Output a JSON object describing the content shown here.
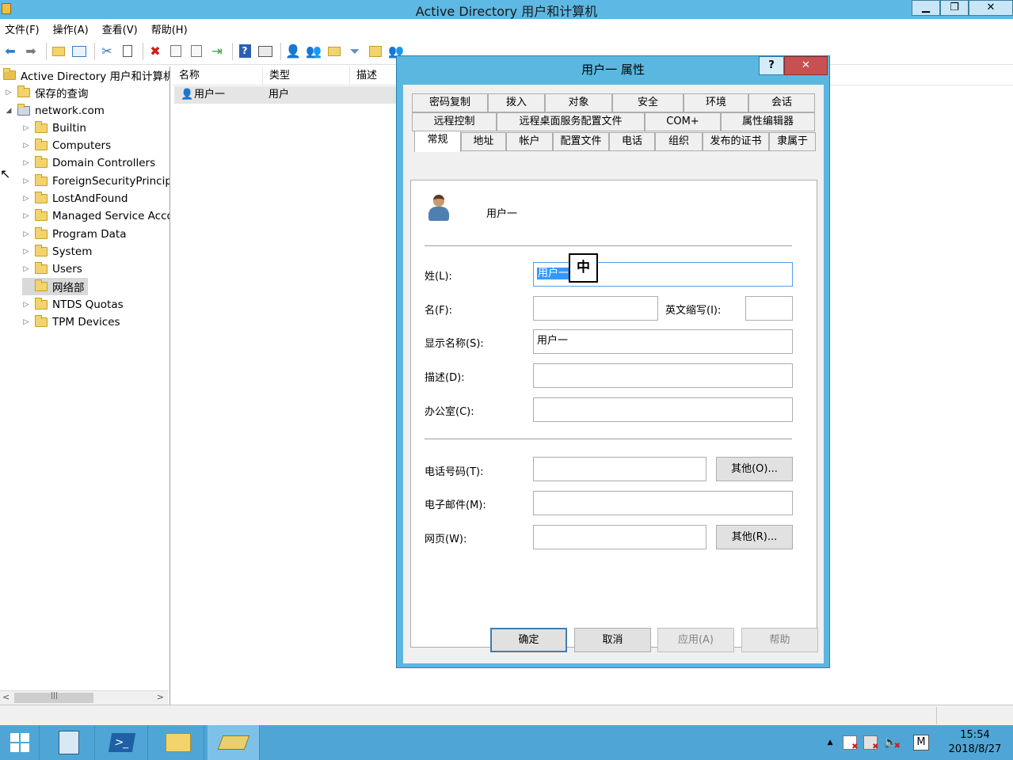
{
  "window": {
    "title": "Active Directory 用户和计算机"
  },
  "menu": [
    "文件(F)",
    "操作(A)",
    "查看(V)",
    "帮助(H)"
  ],
  "toolbar_icons": [
    "back-arrow-icon",
    "forward-arrow-icon",
    "up-folder-icon",
    "show-tree-icon",
    "cut-icon",
    "copy-icon",
    "delete-icon",
    "properties-icon",
    "refresh-icon",
    "export-icon",
    "help-icon",
    "console-icon",
    "new-user-icon",
    "new-group-icon",
    "new-ou-icon",
    "filter-icon",
    "find-icon",
    "add-to-group-icon"
  ],
  "tree": {
    "root": "Active Directory 用户和计算机",
    "saved_queries": "保存的查询",
    "domain": "network.com",
    "children": [
      "Builtin",
      "Computers",
      "Domain Controllers",
      "ForeignSecurityPrincipals",
      "LostAndFound",
      "Managed Service Accounts",
      "Program Data",
      "System",
      "Users",
      "网络部",
      "NTDS Quotas",
      "TPM Devices"
    ]
  },
  "list": {
    "columns": [
      "名称",
      "类型",
      "描述"
    ],
    "rows": [
      {
        "name": "用户一",
        "type": "用户",
        "desc": ""
      }
    ]
  },
  "dialog": {
    "title": "用户一 属性",
    "help_btn": "?",
    "close_btn": "✕",
    "tabs_row1": [
      "密码复制",
      "拨入",
      "对象",
      "安全",
      "环境",
      "会话"
    ],
    "tabs_row2": [
      "远程控制",
      "远程桌面服务配置文件",
      "COM+",
      "属性编辑器"
    ],
    "tabs_row3": [
      "常规",
      "地址",
      "帐户",
      "配置文件",
      "电话",
      "组织",
      "发布的证书",
      "隶属于"
    ],
    "user_name": "用户一",
    "fields": {
      "last_name_label": "姓(L):",
      "last_name_value": "用户一",
      "first_name_label": "名(F):",
      "first_name_value": "",
      "initials_label": "英文缩写(I):",
      "initials_value": "",
      "display_name_label": "显示名称(S):",
      "display_name_value": "用户一",
      "description_label": "描述(D):",
      "description_value": "",
      "office_label": "办公室(C):",
      "office_value": "",
      "phone_label": "电话号码(T):",
      "phone_value": "",
      "phone_other": "其他(O)...",
      "email_label": "电子邮件(M):",
      "email_value": "",
      "web_label": "网页(W):",
      "web_value": "",
      "web_other": "其他(R)..."
    },
    "buttons": {
      "ok": "确定",
      "cancel": "取消",
      "apply": "应用(A)",
      "help": "帮助"
    }
  },
  "ime_indicator": "中",
  "taskbar": {
    "clock_time": "15:54",
    "clock_date": "2018/8/27",
    "ime_mode": "M",
    "tray_up": "▲"
  }
}
